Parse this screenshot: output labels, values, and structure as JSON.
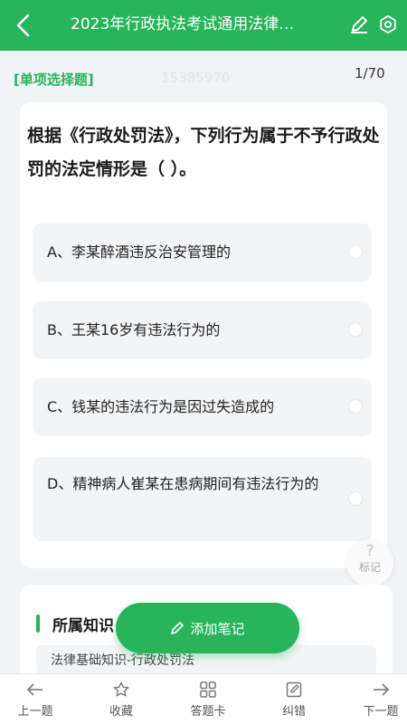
{
  "header": {
    "title": "2023年行政执法考试通用法律…"
  },
  "question": {
    "type_label": "[单项选择题]",
    "watermark": "15385970",
    "counter": "1/70",
    "text": "根据《行政处罚法》，下列行为属于不予行政处罚的法定情形是（ ）。",
    "options": [
      {
        "label": "A、李某醉酒违反治安管理的"
      },
      {
        "label": "B、王某16岁有违法行为的"
      },
      {
        "label": "C、钱某的违法行为是因过失造成的"
      },
      {
        "label": "D、精神病人崔某在患病期间有违法行为的"
      }
    ]
  },
  "help": {
    "glyph": "?",
    "label": "标记"
  },
  "knowledge": {
    "title": "所属知识",
    "path": "法律基础知识-行政处罚法"
  },
  "add_note": {
    "label": "添加笔记"
  },
  "bottom_nav": {
    "prev": "上一题",
    "favorite": "收藏",
    "answer_card": "答题卡",
    "report": "纠错",
    "next": "下一题"
  },
  "colors": {
    "accent": "#27b45a",
    "background": "#f2f3f5"
  },
  "icons": [
    "back-icon",
    "edit-icon",
    "gear-icon",
    "pencil-icon",
    "arrow-left-icon",
    "star-icon",
    "grid-icon",
    "report-icon",
    "arrow-right-icon"
  ]
}
